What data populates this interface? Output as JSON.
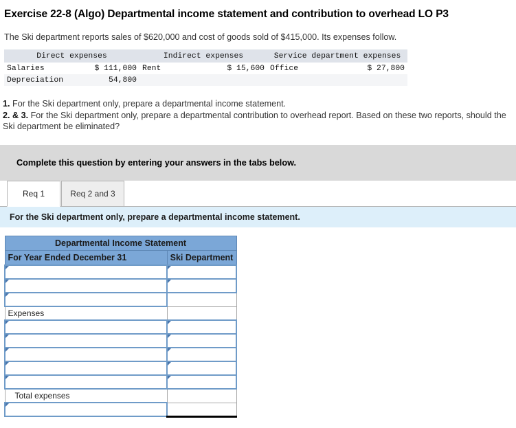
{
  "exercise": {
    "title": "Exercise 22-8 (Algo) Departmental income statement and contribution to overhead LO P3",
    "intro": "The Ski department reports sales of $620,000 and cost of goods sold of $415,000. Its expenses follow."
  },
  "given_table": {
    "headers": [
      "Direct expenses",
      "Indirect expenses",
      "Service department expenses"
    ],
    "rows": [
      {
        "direct_label": "Salaries",
        "direct_value": "$ 111,000",
        "indirect_label": "Rent",
        "indirect_value": "$ 15,600",
        "service_label": "Office",
        "service_value": "$ 27,800"
      },
      {
        "direct_label": "Depreciation",
        "direct_value": "54,800",
        "indirect_label": "",
        "indirect_value": "",
        "service_label": "",
        "service_value": ""
      }
    ]
  },
  "requirements": {
    "line1_num": "1.",
    "line1_text": "For the Ski department only, prepare a departmental income statement.",
    "line2_num": "2. & 3.",
    "line2_text": "For the Ski department only, prepare a departmental contribution to overhead report. Based on these two reports, should the Ski department be eliminated?"
  },
  "banner": {
    "text": "Complete this question by entering your answers in the tabs below."
  },
  "tabs": [
    {
      "label": "Req 1",
      "active": true
    },
    {
      "label": "Req 2 and 3",
      "active": false
    }
  ],
  "sub_instruction": {
    "text": "For the Ski department only, prepare a departmental income statement."
  },
  "sheet": {
    "title": "Departmental Income Statement",
    "col_header_left": "For Year Ended December 31",
    "col_header_right": "Ski Department",
    "rows": [
      {
        "label": "",
        "kind": "input",
        "value_kind": "input",
        "value": ""
      },
      {
        "label": "",
        "kind": "input",
        "value_kind": "input",
        "value": ""
      },
      {
        "label": "",
        "kind": "input",
        "value_kind": "plain",
        "value": ""
      },
      {
        "label": "Expenses",
        "kind": "label",
        "value_kind": "plain",
        "value": ""
      },
      {
        "label": "",
        "kind": "input",
        "value_kind": "input",
        "value": ""
      },
      {
        "label": "",
        "kind": "input",
        "value_kind": "input",
        "value": ""
      },
      {
        "label": "",
        "kind": "input",
        "value_kind": "input",
        "value": ""
      },
      {
        "label": "",
        "kind": "input",
        "value_kind": "input",
        "value": ""
      },
      {
        "label": "",
        "kind": "input",
        "value_kind": "input",
        "value": ""
      },
      {
        "label": "Total expenses",
        "kind": "label-indent",
        "value_kind": "plain",
        "value": ""
      },
      {
        "label": "",
        "kind": "input",
        "value_kind": "plain-dotted",
        "value": ""
      }
    ]
  },
  "colors": {
    "sheet_header_blue": "#7ba7d7",
    "input_border_blue": "#6f9bc8",
    "banner_gray": "#d9d9d9",
    "sub_instruction_blue": "#ddeffa",
    "given_header_gray": "#dfe3ea"
  }
}
